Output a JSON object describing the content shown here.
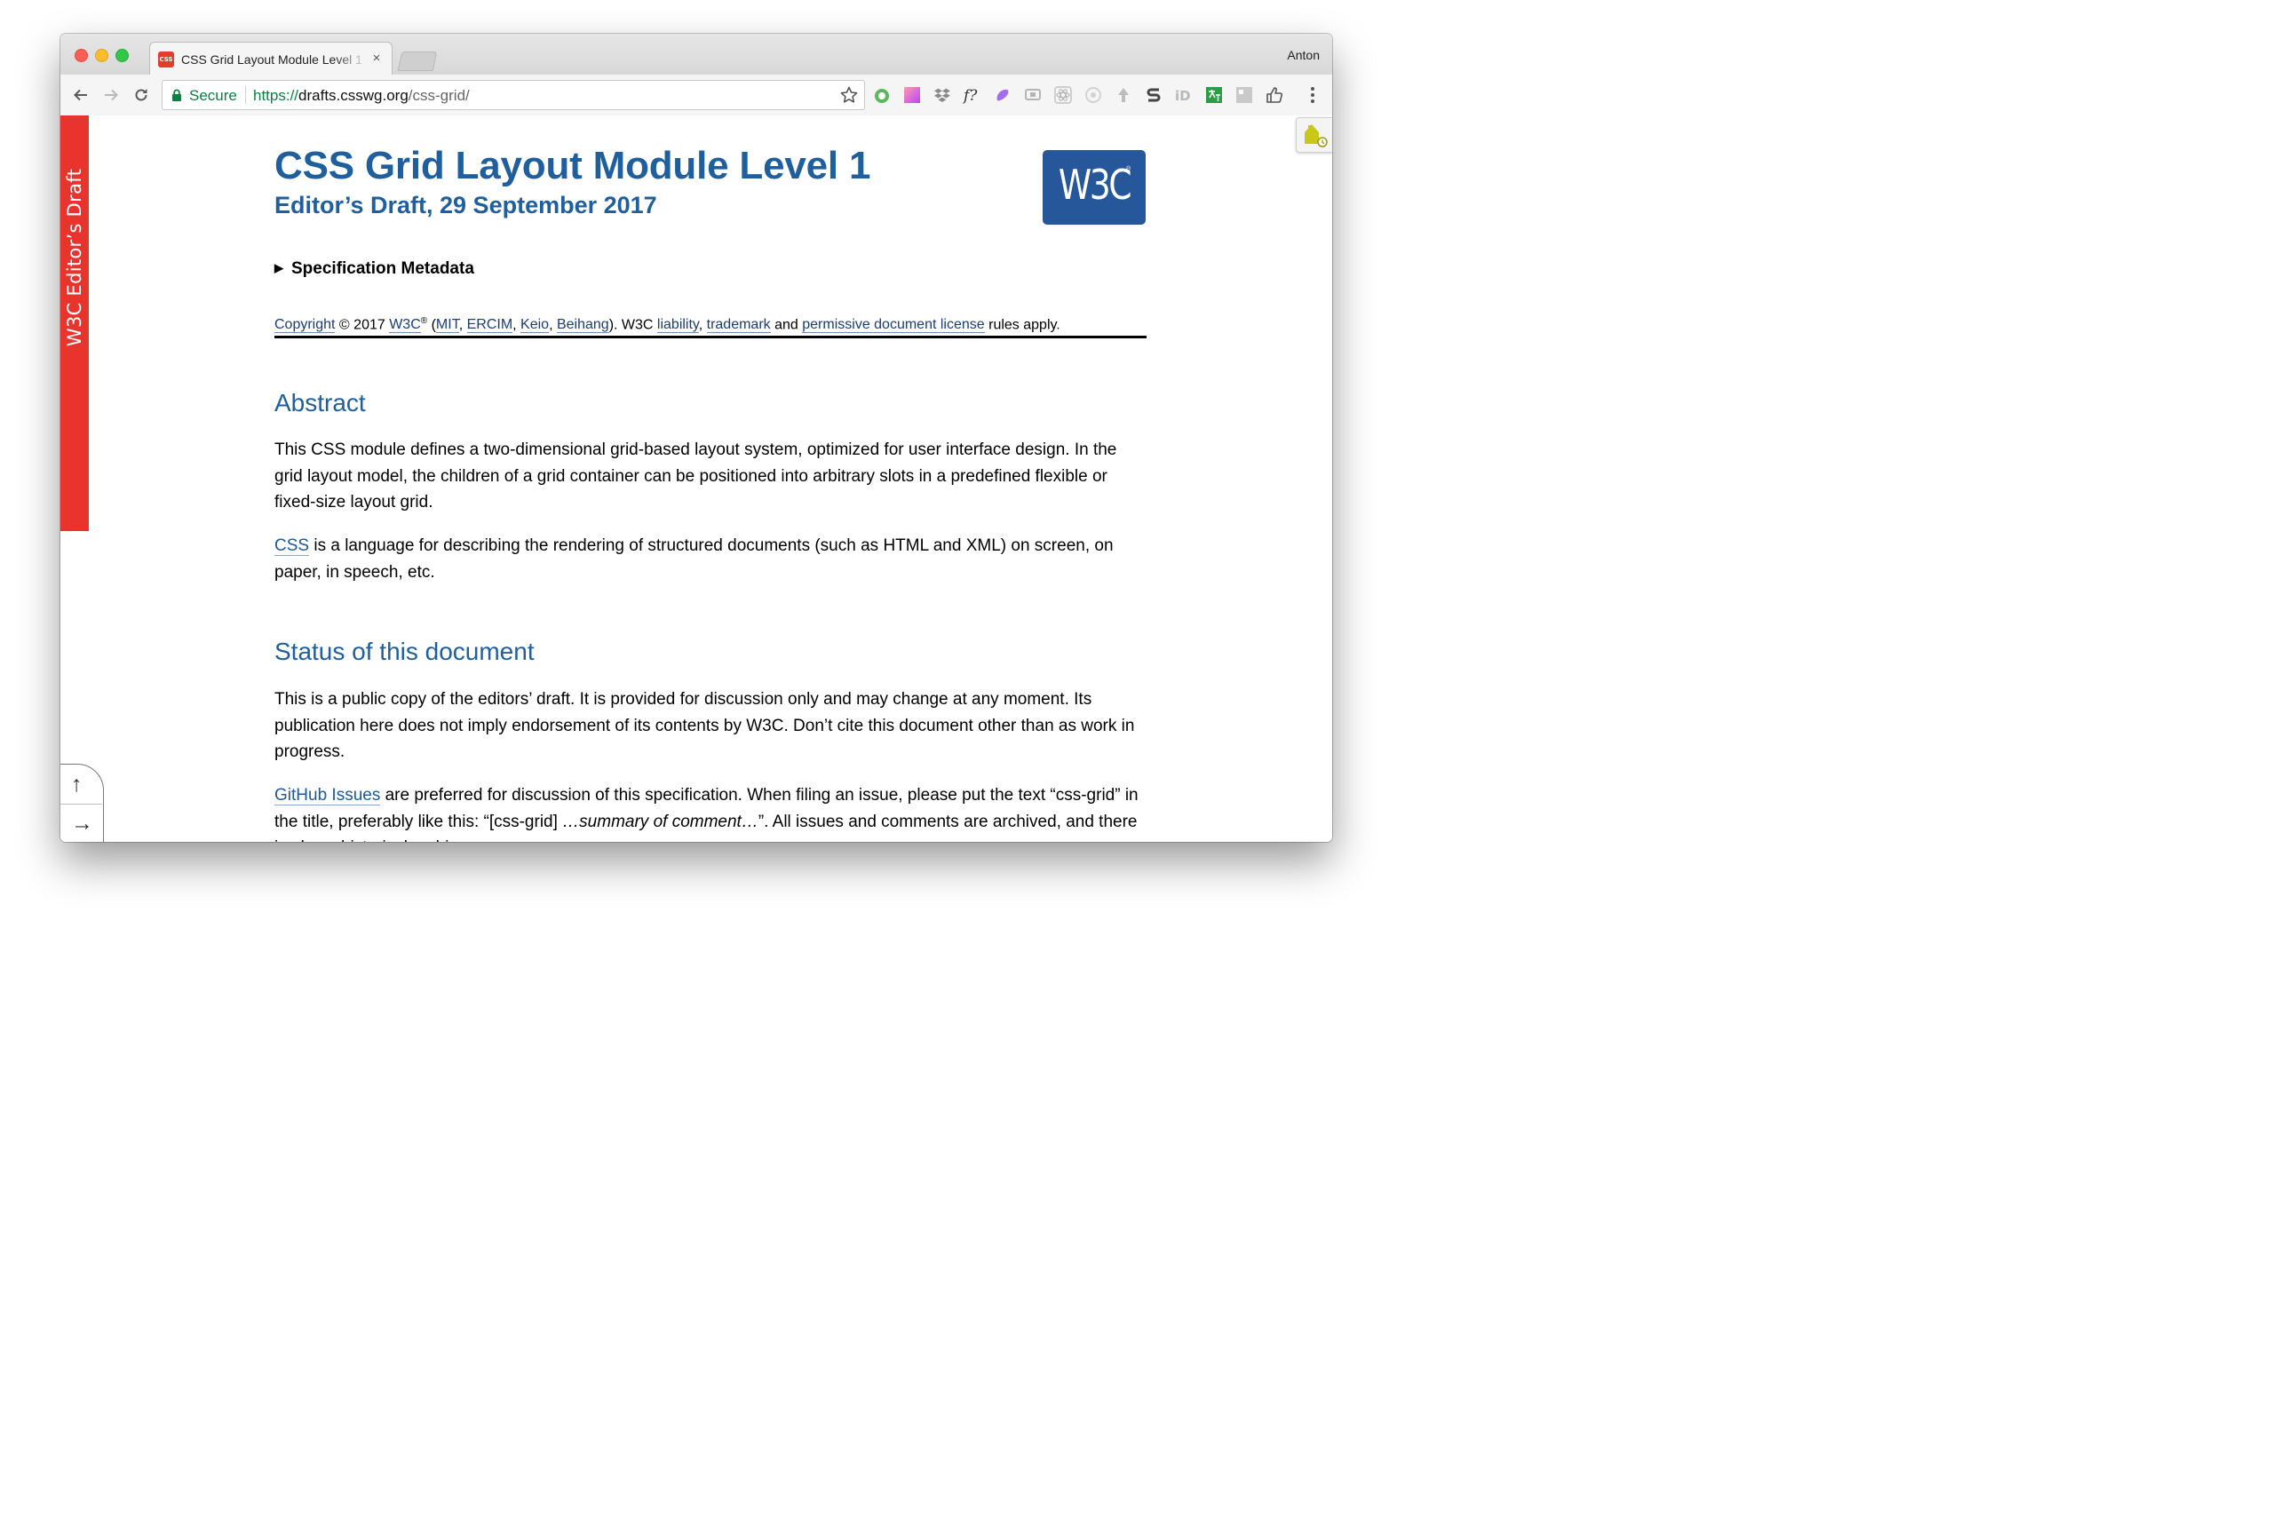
{
  "browser": {
    "tab": {
      "favicon_text": "CSS",
      "title": "CSS Grid Layout Module Level 1",
      "close_symbol": "×"
    },
    "profile_name": "Anton",
    "omnibox": {
      "secure_label": "Secure",
      "url_scheme": "https://",
      "url_host": "drafts.csswg.org",
      "url_path": "/css-grid/"
    },
    "extensions": [
      "tomato-ext-icon",
      "palette-ext-icon",
      "dropbox-icon",
      "font-ext-icon",
      "blob-ext-icon",
      "cast-ext-icon",
      "react-devtools-icon",
      "circle-ext-icon",
      "arrow-ext-icon",
      "s-ext-icon",
      "id-ext-icon",
      "translate-ext-icon",
      "grid-ext-icon",
      "thumbs-up-icon"
    ]
  },
  "sidebar": {
    "banner_text": "W3C Editor’s Draft",
    "nav_up_symbol": "↑",
    "nav_right_symbol": "→"
  },
  "document": {
    "title": "CSS Grid Layout Module Level 1",
    "subtitle": "Editor’s Draft, 29 September 2017",
    "logo_text": "W3C",
    "logo_reg": "®",
    "metadata_toggle": "Specification Metadata",
    "copyright": {
      "copyright_link": "Copyright",
      "year_text": " © 2017 ",
      "w3c_link": "W3C",
      "w3c_sup": "®",
      "open_paren": " (",
      "mit_link": "MIT",
      "comma1": ", ",
      "ercim_link": "ERCIM",
      "comma2": ", ",
      "keio_link": "Keio",
      "comma3": ", ",
      "beihang_link": "Beihang",
      "close_text": "). W3C ",
      "liability_link": "liability",
      "comma4": ", ",
      "trademark_link": "trademark",
      "and_text": " and ",
      "license_link": "permissive document license",
      "rules_text": " rules apply."
    },
    "abstract": {
      "heading": "Abstract",
      "p1": "This CSS module defines a two-dimensional grid-based layout system, optimized for user interface design. In the grid layout model, the children of a grid container can be positioned into arbitrary slots in a predefined flexible or fixed-size layout grid.",
      "p2_link": "CSS",
      "p2_text": " is a language for describing the rendering of structured documents (such as HTML and XML) on screen, on paper, in speech, etc."
    },
    "status": {
      "heading": "Status of this document",
      "p1": "This is a public copy of the editors’ draft. It is provided for discussion only and may change at any moment. Its publication here does not imply endorsement of its contents by W3C. Don’t cite this document other than as work in progress.",
      "p2_link": "GitHub Issues",
      "p2_text_a": " are preferred for discussion of this specification. When filing an issue, please put the text “css-grid” in the title, preferably like this: “[css-grid] ",
      "p2_em": "…summary of comment…",
      "p2_text_b": "”. All issues and comments are archived, and there is also a historical archive."
    }
  },
  "colors": {
    "banner_red": "#e8342c",
    "heading_blue": "#1f5f9e",
    "logo_blue": "#25579a",
    "secure_green": "#0b8043"
  }
}
